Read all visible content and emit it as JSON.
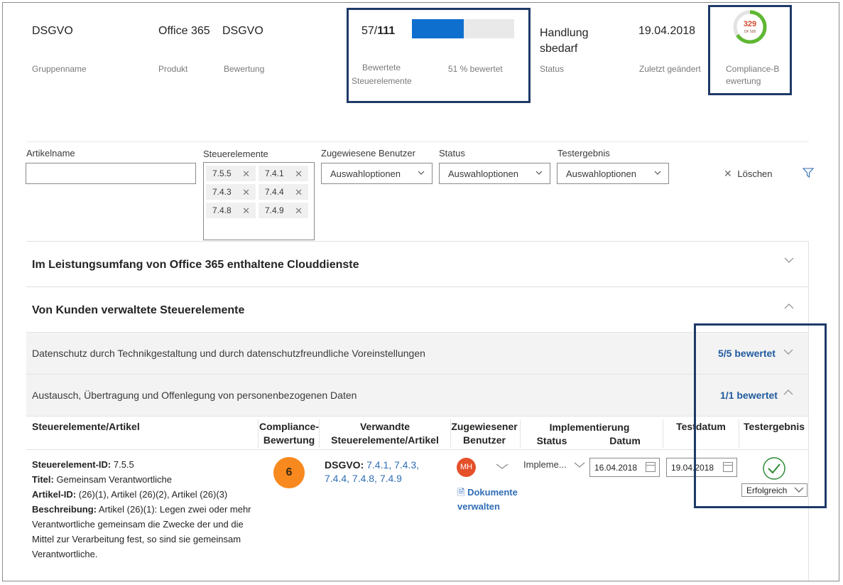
{
  "header": {
    "group_value": "DSGVO",
    "group_label": "Gruppenname",
    "product_value": "Office 365",
    "product_label": "Produkt",
    "assessment_value": "DSGVO",
    "assessment_label": "Bewertung",
    "progress_done": "57/",
    "progress_total": "111",
    "progress_fraction": 0.51,
    "progress_label_line1": "Bewertete",
    "progress_label_line2": "Steuerelemente",
    "progress_percent_text": "51 % bewertet",
    "status_line1": "Handlung",
    "status_line2": "sbedarf",
    "status_label": "Status",
    "changed_value": "19.04.2018",
    "changed_label": "Zuletzt geändert",
    "score_value": "329",
    "score_sub": "OF 500",
    "score_fraction": 0.658,
    "score_label_line1": "Compliance-B",
    "score_label_line2": "ewertung"
  },
  "filters": {
    "article_label": "Artikelname",
    "article_value": "",
    "controls_label": "Steuerelemente",
    "controls_tags": [
      "7.5.5",
      "7.4.1",
      "7.4.3",
      "7.4.4",
      "7.4.8",
      "7.4.9"
    ],
    "users_label": "Zugewiesene Benutzer",
    "users_value": "Auswahloptionen",
    "status_label": "Status",
    "status_value": "Auswahloptionen",
    "result_label": "Testergebnis",
    "result_value": "Auswahloptionen",
    "clear_label": "Löschen"
  },
  "sections": {
    "cloud_title": "Im Leistungsumfang von Office 365 enthaltene Clouddienste",
    "customer_title": "Von Kunden verwaltete Steuerelemente",
    "sub1_title": "Datenschutz durch Technikgestaltung und durch datenschutzfreundliche Voreinstellungen",
    "sub1_count": "5/5 bewertet",
    "sub2_title": "Austausch, Übertragung und Offenlegung von personenbezogenen Daten",
    "sub2_count": "1/1 bewertet"
  },
  "table": {
    "h_control": "Steuerelemente/Artikel",
    "h_score_1": "Compliance-",
    "h_score_2": "Bewertung",
    "h_related_1": "Verwandte",
    "h_related_2": "Steuerelemente/Artikel",
    "h_user_1": "Zugewiesener",
    "h_user_2": "Benutzer",
    "h_impl": "Implementierung",
    "h_impl_status": "Status",
    "h_impl_date": "Datum",
    "h_testdate": "Testdatum",
    "h_result": "Testergebnis"
  },
  "row": {
    "id_label": "Steuerelement-ID:",
    "id_value": " 7.5.5",
    "title_label": "Titel:",
    "title_value": " Gemeinsam Verantwortliche",
    "article_label": "Artikel-ID:",
    "article_value": " (26)(1), Artikel (26)(2), Artikel (26)(3)",
    "desc_label": "Beschreibung:",
    "desc_line1": " Artikel (26)(1): Legen zwei oder mehr",
    "desc_line2": "Verantwortliche gemeinsam die Zwecke der und die",
    "desc_line3": "Mittel zur Verarbeitung fest, so sind sie gemeinsam",
    "desc_line4": "Verantwortliche.",
    "score": "6",
    "related_prefix": "DSGVO:",
    "related_line1": " 7.4.1, 7.4.3,",
    "related_line2": "7.4.4, 7.4.8, 7.4.9",
    "user_initials": "MH",
    "docs_line1": "Dokumente",
    "docs_line2": "verwalten",
    "impl_status": "Impleme...",
    "impl_date": "16.04.2018",
    "test_date": "19.04.2018",
    "result_value": "Erfolgreich"
  },
  "colors": {
    "progress": "#0f6fce",
    "highlight_border": "#1f3a68",
    "score_badge": "#f7891e",
    "donut_green": "#5fb832",
    "success": "#2e8b36",
    "link": "#2f6db5",
    "avatar": "#e5502b"
  }
}
